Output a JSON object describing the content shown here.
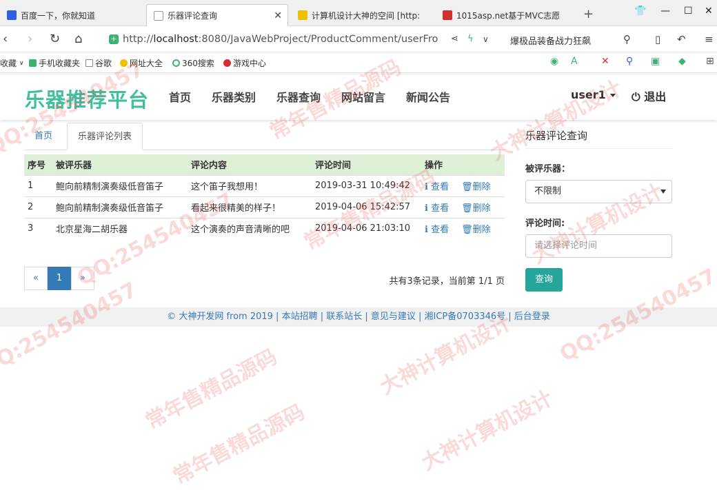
{
  "browser": {
    "tabs": [
      {
        "label": "百度一下，你就知道",
        "fav": "#3060e0",
        "active": false
      },
      {
        "label": "乐器评论查询",
        "fav": "#aaa",
        "active": true
      },
      {
        "label": "计算机设计大神的空间 [http:",
        "fav": "#f0c000",
        "active": false
      },
      {
        "label": "1015asp.net基于MVC志愿",
        "fav": "#d03030",
        "active": false
      }
    ],
    "url_scheme": "http://",
    "url_host": "localhost",
    "url_rest": ":8080/JavaWebProject/ProductComment/userFro",
    "ad_text": "爆极品装备战力狂飙",
    "bookmarks": [
      {
        "label": "收藏",
        "color": "#999"
      },
      {
        "label": "手机收藏夹",
        "color": "#3cb371"
      },
      {
        "label": "谷歌",
        "color": "#888"
      },
      {
        "label": "网址大全",
        "color": "#f0c000"
      },
      {
        "label": "360搜索",
        "color": "#3cb371"
      },
      {
        "label": "游戏中心",
        "color": "#d03030"
      }
    ]
  },
  "header": {
    "brand": "乐器推荐平台",
    "nav": [
      "首页",
      "乐器类别",
      "乐器查询",
      "网站留言",
      "新闻公告"
    ],
    "user": "user1",
    "logout": "退出"
  },
  "page_tabs": {
    "home": "首页",
    "current": "乐器评论列表"
  },
  "table": {
    "headers": [
      "序号",
      "被评乐器",
      "评论内容",
      "评论时间",
      "操作"
    ],
    "rows": [
      {
        "no": "1",
        "product": "鲍向前精制演奏级低音笛子",
        "content": "这个笛子我想用！",
        "time": "2019-03-31 10:49:42"
      },
      {
        "no": "2",
        "product": "鲍向前精制演奏级低音笛子",
        "content": "看起来很精美的样子！",
        "time": "2019-04-06 15:42:57"
      },
      {
        "no": "3",
        "product": "北京星海二胡乐器",
        "content": "这个演奏的声音清晰的吧",
        "time": "2019-04-06 21:03:10"
      }
    ],
    "view_label": "查看",
    "delete_label": "删除"
  },
  "pager": {
    "prev": "«",
    "current": "1",
    "next": "»",
    "info": "共有3条记录，当前第 1/1 页"
  },
  "side": {
    "title": "乐器评论查询",
    "product_label": "被评乐器：",
    "product_value": "不限制",
    "time_label": "评论时间:",
    "time_placeholder": "请选择评论时间",
    "query_button": "查询"
  },
  "footer": "© 大神开发网 from 2019 | 本站招聘 | 联系站长 | 意见与建议 | 湘ICP备0703346号 | 后台登录",
  "watermarks": [
    "QQ:254540457",
    "常年售精品源码",
    "大神计算机设计",
    "QQ:254540457",
    "常年售精品源码",
    "大神计算机设计",
    "QQ:254540457",
    "常年售精品源码",
    "大神计算机设计",
    "QQ:254540457",
    "常年售精品源码",
    "大神计算机设计"
  ]
}
